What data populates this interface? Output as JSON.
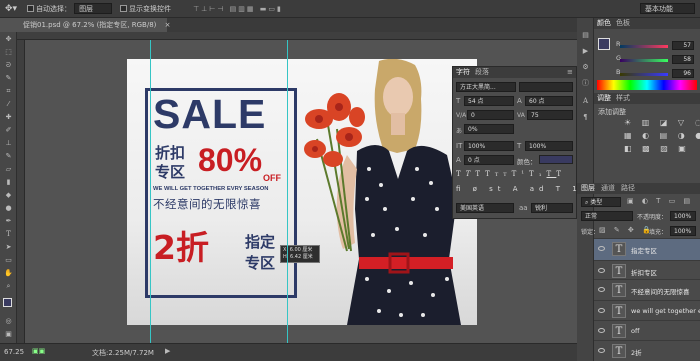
{
  "options_bar": {
    "auto_select": "自动选择：",
    "group": "图层",
    "show_transform": "显示变换控件",
    "workspace": "基本功能"
  },
  "document": {
    "tab_title": "促销01.psd @ 67.2% (指定专区, RGB/8)",
    "close": "×"
  },
  "status": {
    "zoom": "67.25",
    "doc_size": "文档:2.25M/7.72M"
  },
  "tooltip": {
    "line1": "X: 6.00 厘米",
    "line2": "H: 6.42 厘米"
  },
  "artwork": {
    "sale": "SALE",
    "discount": "折扣",
    "zone": "专区",
    "percent": "80%",
    "off": "OFF",
    "tagline_en": "WE WILL GET TOGETHER EVRY SEASON",
    "tagline_cn": "不经意间的无限惊喜",
    "two_zhe": "2折",
    "designated_1": "指定",
    "designated_2": "专区"
  },
  "color_panel": {
    "tab1": "颜色",
    "tab2": "色板",
    "r_label": "R",
    "g_label": "G",
    "b_label": "B",
    "r": "57",
    "g": "58",
    "b": "96"
  },
  "adjust_panel": {
    "tab1": "调整",
    "tab2": "样式",
    "title": "添加调整"
  },
  "char_panel": {
    "tab1": "字符",
    "tab2": "段落",
    "font": "方正大黑简...",
    "size": "54 点",
    "leading": "60 点",
    "tracking": "0",
    "kerning": "75",
    "scale_v": "100%",
    "scale_h": "100%",
    "baseline": "0 点",
    "color_label": "颜色：",
    "percent": "0%",
    "language": "美国英语",
    "aa": "锐利",
    "aa_label": "aa"
  },
  "layers_panel": {
    "tab1": "图层",
    "tab2": "通道",
    "tab3": "路径",
    "filter": "类型",
    "blend": "正常",
    "opacity_label": "不透明度：",
    "opacity": "100%",
    "lock_label": "锁定：",
    "fill_label": "填充：",
    "fill": "100%",
    "layers": [
      {
        "name": "指定专区"
      },
      {
        "name": "折扣专区"
      },
      {
        "name": "不经意间的无限惊喜"
      },
      {
        "name": "we will get together evry sea..."
      },
      {
        "name": "off"
      },
      {
        "name": "2折"
      }
    ]
  },
  "colors": {
    "navy": "#2d3a67",
    "red": "#c81e23",
    "guide": "#36c5c5"
  }
}
